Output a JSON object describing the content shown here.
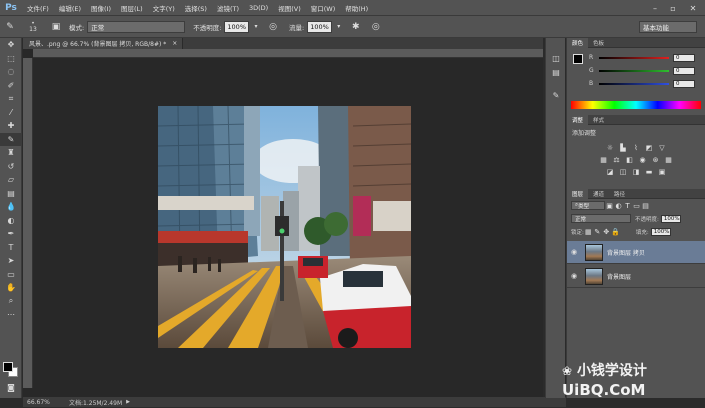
{
  "app": {
    "logo": "Ps"
  },
  "menu": [
    "文件(F)",
    "编辑(E)",
    "图像(I)",
    "图层(L)",
    "文字(Y)",
    "选择(S)",
    "滤镜(T)",
    "3D(D)",
    "视图(V)",
    "窗口(W)",
    "帮助(H)"
  ],
  "options": {
    "brush_size": "13",
    "mode_label": "模式:",
    "mode_value": "正常",
    "opacity_label": "不透明度:",
    "opacity_value": "100%",
    "flow_label": "流量:",
    "flow_value": "100%",
    "workspace": "基本功能"
  },
  "document": {
    "tab_title": "风景、.png @ 66.7% (背景图层 拷贝, RGB/8#) *",
    "zoom": "66.67%",
    "doc_info": "文档:1.25M/2.49M"
  },
  "color_panel": {
    "tabs": [
      "颜色",
      "色板"
    ],
    "channels": [
      {
        "label": "R",
        "value": "0",
        "color": "#e0211f"
      },
      {
        "label": "G",
        "value": "0",
        "color": "#2fbf2f"
      },
      {
        "label": "B",
        "value": "0",
        "color": "#2f4fe0"
      }
    ]
  },
  "adjust_panel": {
    "tabs": [
      "调整",
      "样式"
    ],
    "title": "添加调整"
  },
  "layers_panel": {
    "tabs": [
      "图层",
      "通道",
      "路径"
    ],
    "kind": "类型",
    "blend": "正常",
    "opacity_label": "不透明度:",
    "opacity_value": "100%",
    "lock_label": "锁定:",
    "fill_label": "填充:",
    "fill_value": "100%",
    "layers": [
      {
        "name": "背景图层 拷贝",
        "selected": true
      },
      {
        "name": "背景图层",
        "selected": false
      }
    ]
  },
  "watermark": {
    "line1": "小钱学设计",
    "line2": "UiBQ.CoM"
  }
}
